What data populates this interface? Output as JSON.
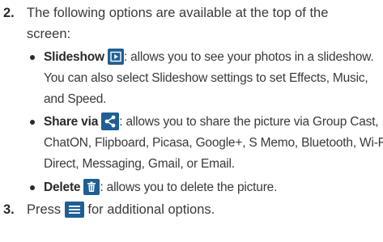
{
  "steps": [
    {
      "number": "2.",
      "text_line1": "The following options are available at the top of the",
      "text_line2": "screen:"
    },
    {
      "number": "3.",
      "text_before": "Press",
      "text_after": "for additional options."
    }
  ],
  "bullets": [
    {
      "term": "Slideshow",
      "icon": "slideshow-play-icon",
      "line1": ": allows you to see your photos in a slideshow.",
      "line2": "You can also select Slideshow settings to set Effects, Music,",
      "line3": "and Speed."
    },
    {
      "term": "Share via",
      "icon": "share-icon",
      "line1": ": allows you to share the picture via Group Cast,",
      "line2": "ChatON, Flipboard, Picasa, Google+, S Memo, Bluetooth, Wi-Fi",
      "line3": "Direct, Messaging, Gmail, or Email."
    },
    {
      "term": "Delete",
      "icon": "trash-icon",
      "line1": ": allows you to delete the picture."
    }
  ],
  "colors": {
    "icon_background": "#1f5f93",
    "text": "#3a3a3a"
  }
}
